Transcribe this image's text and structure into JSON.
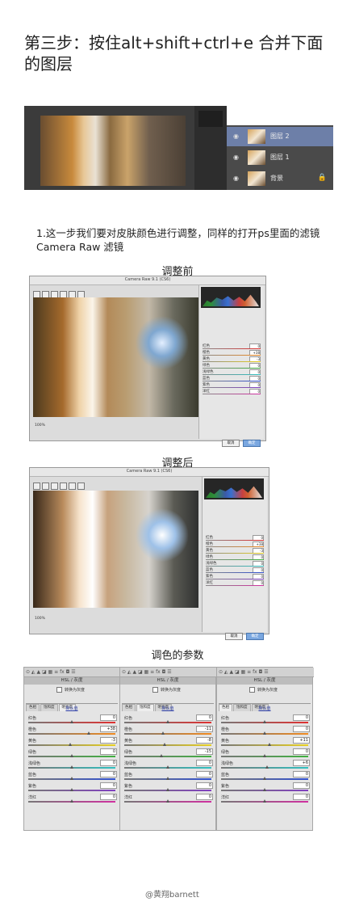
{
  "title": "第三步：按住alt+shift+ctrl+e 合并下面的图层",
  "layers": [
    {
      "name": "图层 2",
      "selected": true
    },
    {
      "name": "图层 1",
      "selected": false
    },
    {
      "name": "背景",
      "selected": false
    }
  ],
  "step1_caption": "1.这一步我们要对皮肤颜色进行调整，同样的打开ps里面的滤镜Camera Raw 滤镜",
  "label_before": "调整前",
  "label_after": "调整后",
  "label_params": "调色的参数",
  "dialog_title": "Camera Raw 9.1 (CS6)",
  "dialog_buttons": {
    "cancel": "取消",
    "ok": "确定"
  },
  "hsl": {
    "header": "HSL / 灰度",
    "grayscale_label": "转换为灰度",
    "tabs": [
      "色相",
      "饱和度",
      "明亮度"
    ],
    "default_link": "默认值",
    "colors": [
      "红色",
      "橙色",
      "黄色",
      "绿色",
      "浅绿色",
      "蓝色",
      "紫色",
      "洋红"
    ],
    "swatches": [
      "#e03030",
      "#f08a20",
      "#e8d020",
      "#40b040",
      "#30c0c0",
      "#3050d0",
      "#8040c0",
      "#d030a0"
    ],
    "panels": [
      {
        "active_tab": 2,
        "values": [
          "0",
          "+38",
          "-3",
          "0",
          "0",
          "0",
          "0",
          "0"
        ]
      },
      {
        "active_tab": 1,
        "values": [
          "0",
          "-11",
          "-8",
          "-15",
          "0",
          "0",
          "0",
          "0"
        ]
      },
      {
        "active_tab": 0,
        "values": [
          "0",
          "0",
          "+11",
          "0",
          "+6",
          "0",
          "0",
          "0"
        ]
      }
    ]
  },
  "watermark": "@黄翔barnett"
}
